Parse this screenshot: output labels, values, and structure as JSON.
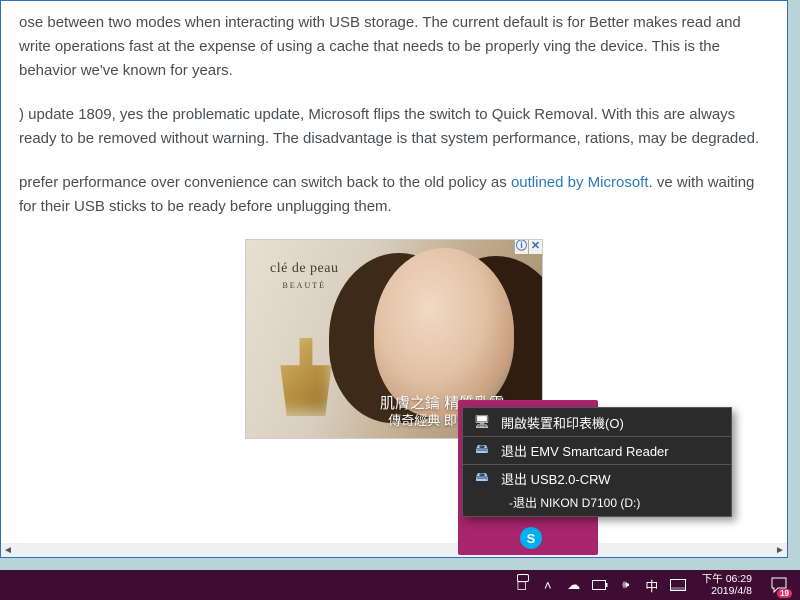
{
  "article": {
    "p1": "ose between two modes when interacting with USB storage. The current default is for Better makes read and write operations fast at the expense of using a cache that needs to be properly ving the device. This is the behavior we've known for years.",
    "p2": ") update 1809, yes the problematic update, Microsoft flips the switch to Quick Removal. With this are always ready to be removed without warning. The disadvantage is that system performance, rations, may be degraded.",
    "p3a": " prefer performance over convenience can switch back to the old policy as ",
    "p3_link": "outlined by Microsoft",
    "p3b": ". ve with waiting for their USB sticks to be ready before unplugging them."
  },
  "ad": {
    "brand": "clé de peau",
    "brand_sub": "BEAUTÉ",
    "line1": "肌膚之鑰 精質乳霜",
    "line2": "傳奇經典 即刻收藏",
    "info_symbol": "ⓘ",
    "close_symbol": "✕"
  },
  "context_menu": {
    "open_devices": "開啟裝置和印表機(O)",
    "eject_smartcard": "退出 EMV Smartcard Reader",
    "eject_usb": "退出 USB2.0-CRW",
    "eject_nikon_prefix": "- ",
    "eject_nikon": "退出 NIKON D7100 (D:)"
  },
  "tray": {
    "skype_glyph": "S",
    "people_glyph": "👥",
    "chevron_glyph": "˄",
    "cloud_glyph": "☁",
    "battery_glyph": "▢",
    "volume_glyph": "🔊",
    "ime_glyph": "中",
    "taskview_glyph": "▭"
  },
  "clock": {
    "time": "下午 06:29",
    "date": "2019/4/8"
  },
  "notifications": {
    "count": "19"
  },
  "scroll": {
    "left": "◄",
    "right": "►"
  }
}
